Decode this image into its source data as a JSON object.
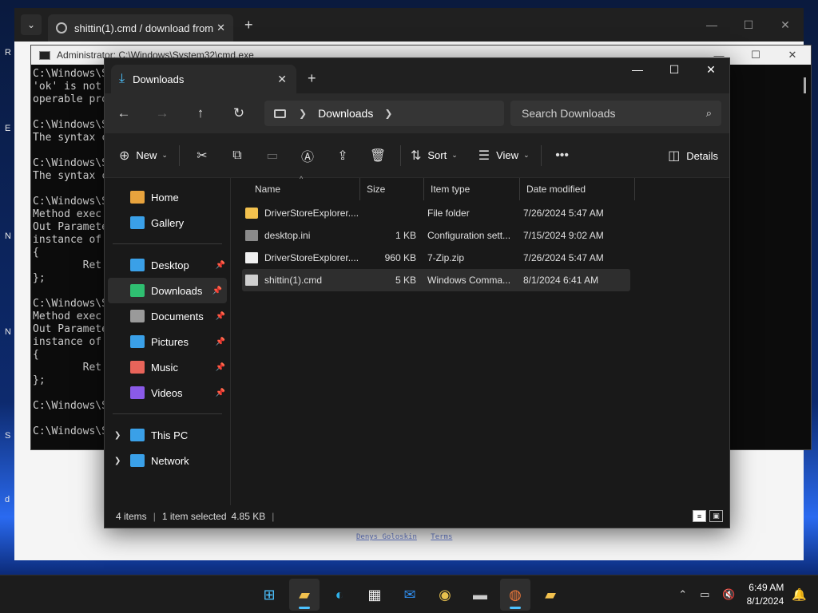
{
  "desktop": {
    "glyphs": [
      "R",
      "E",
      "N",
      "N",
      "S",
      "d"
    ]
  },
  "browser": {
    "tab_title": "shittin(1).cmd / download from",
    "footer_links": [
      "Denys Goloskin",
      "Terms"
    ]
  },
  "cmd": {
    "title": "Administrator: C:\\Windows\\System32\\cmd.exe",
    "lines": [
      "C:\\Windows\\S",
      "'ok' is not",
      "operable pro",
      "",
      "C:\\Windows\\S",
      "The syntax c",
      "",
      "C:\\Windows\\S",
      "The syntax c",
      "",
      "C:\\Windows\\S",
      "Method exec",
      "Out Paramete",
      "instance of",
      "{",
      "        Ret",
      "};",
      "",
      "C:\\Windows\\S",
      "Method exec",
      "Out Paramete",
      "instance of",
      "{",
      "        Ret",
      "};",
      "",
      "C:\\Windows\\S",
      "",
      "C:\\Windows\\S"
    ]
  },
  "explorer": {
    "tab_title": "Downloads",
    "address": {
      "segment": "Downloads"
    },
    "search": {
      "placeholder": "Search Downloads"
    },
    "toolbar": {
      "new_label": "New",
      "sort_label": "Sort",
      "view_label": "View",
      "details_label": "Details"
    },
    "sidebar": {
      "top": [
        {
          "label": "Home",
          "icon": "home-icon",
          "color": "#e8a33d"
        },
        {
          "label": "Gallery",
          "icon": "gallery-icon",
          "color": "#3aa0e8"
        }
      ],
      "pinned": [
        {
          "label": "Desktop",
          "icon": "desktop-icon",
          "color": "#3aa0e8"
        },
        {
          "label": "Downloads",
          "icon": "download-icon",
          "color": "#2fbf71"
        },
        {
          "label": "Documents",
          "icon": "documents-icon",
          "color": "#9a9a9a"
        },
        {
          "label": "Pictures",
          "icon": "pictures-icon",
          "color": "#3aa0e8"
        },
        {
          "label": "Music",
          "icon": "music-icon",
          "color": "#e8645a"
        },
        {
          "label": "Videos",
          "icon": "videos-icon",
          "color": "#8a5ae8"
        }
      ],
      "bottom": [
        {
          "label": "This PC",
          "icon": "pc-icon",
          "color": "#3aa0e8"
        },
        {
          "label": "Network",
          "icon": "network-icon",
          "color": "#3aa0e8"
        }
      ]
    },
    "columns": [
      "Name",
      "Size",
      "Item type",
      "Date modified"
    ],
    "files": [
      {
        "name": "DriverStoreExplorer....",
        "size": "",
        "type": "File folder",
        "date": "7/26/2024 5:47 AM",
        "icon": "folder-icon",
        "color": "#f2c14e"
      },
      {
        "name": "desktop.ini",
        "size": "1 KB",
        "type": "Configuration sett...",
        "date": "7/15/2024 9:02 AM",
        "icon": "config-file-icon",
        "color": "#8a8a8a"
      },
      {
        "name": "DriverStoreExplorer....",
        "size": "960 KB",
        "type": "7-Zip.zip",
        "date": "7/26/2024 5:47 AM",
        "icon": "file-icon",
        "color": "#f0f0f0"
      },
      {
        "name": "shittin(1).cmd",
        "size": "5 KB",
        "type": "Windows Comma...",
        "date": "8/1/2024 6:41 AM",
        "icon": "cmd-file-icon",
        "color": "#cfcfcf"
      }
    ],
    "selected_index": 3,
    "status": {
      "items": "4 items",
      "selected": "1 item selected",
      "size": "4.85 KB"
    }
  },
  "taskbar": {
    "apps": [
      "windows-start-icon",
      "file-explorer-icon",
      "edge-icon",
      "store-icon",
      "outlook-icon",
      "chrome-icon",
      "terminal-icon",
      "firefox-icon",
      "folder-icon"
    ],
    "time": "6:49 AM",
    "date": "8/1/2024"
  }
}
